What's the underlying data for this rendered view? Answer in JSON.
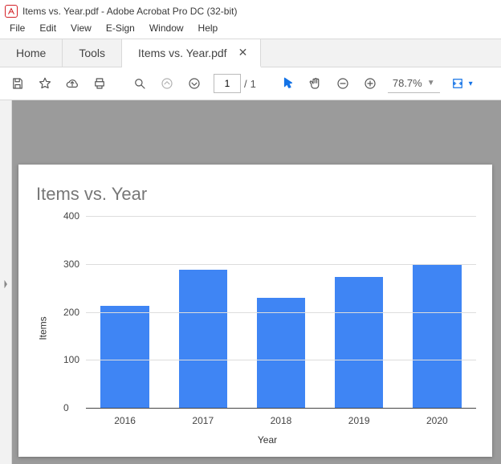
{
  "window": {
    "title": "Items vs. Year.pdf - Adobe Acrobat Pro DC (32-bit)"
  },
  "menu": {
    "file": "File",
    "edit": "Edit",
    "view": "View",
    "esign": "E-Sign",
    "window": "Window",
    "help": "Help"
  },
  "tabs": {
    "home": "Home",
    "tools": "Tools",
    "doc": "Items vs. Year.pdf"
  },
  "toolbar": {
    "page_current": "1",
    "page_sep": "/",
    "page_total": "1",
    "zoom": "78.7%"
  },
  "chart_data": {
    "type": "bar",
    "title": "Items vs. Year",
    "xlabel": "Year",
    "ylabel": "Items",
    "categories": [
      "2016",
      "2017",
      "2018",
      "2019",
      "2020"
    ],
    "values": [
      213,
      288,
      230,
      273,
      300
    ],
    "yticks": [
      0,
      100,
      200,
      300,
      400
    ],
    "ylim": [
      0,
      400
    ]
  }
}
